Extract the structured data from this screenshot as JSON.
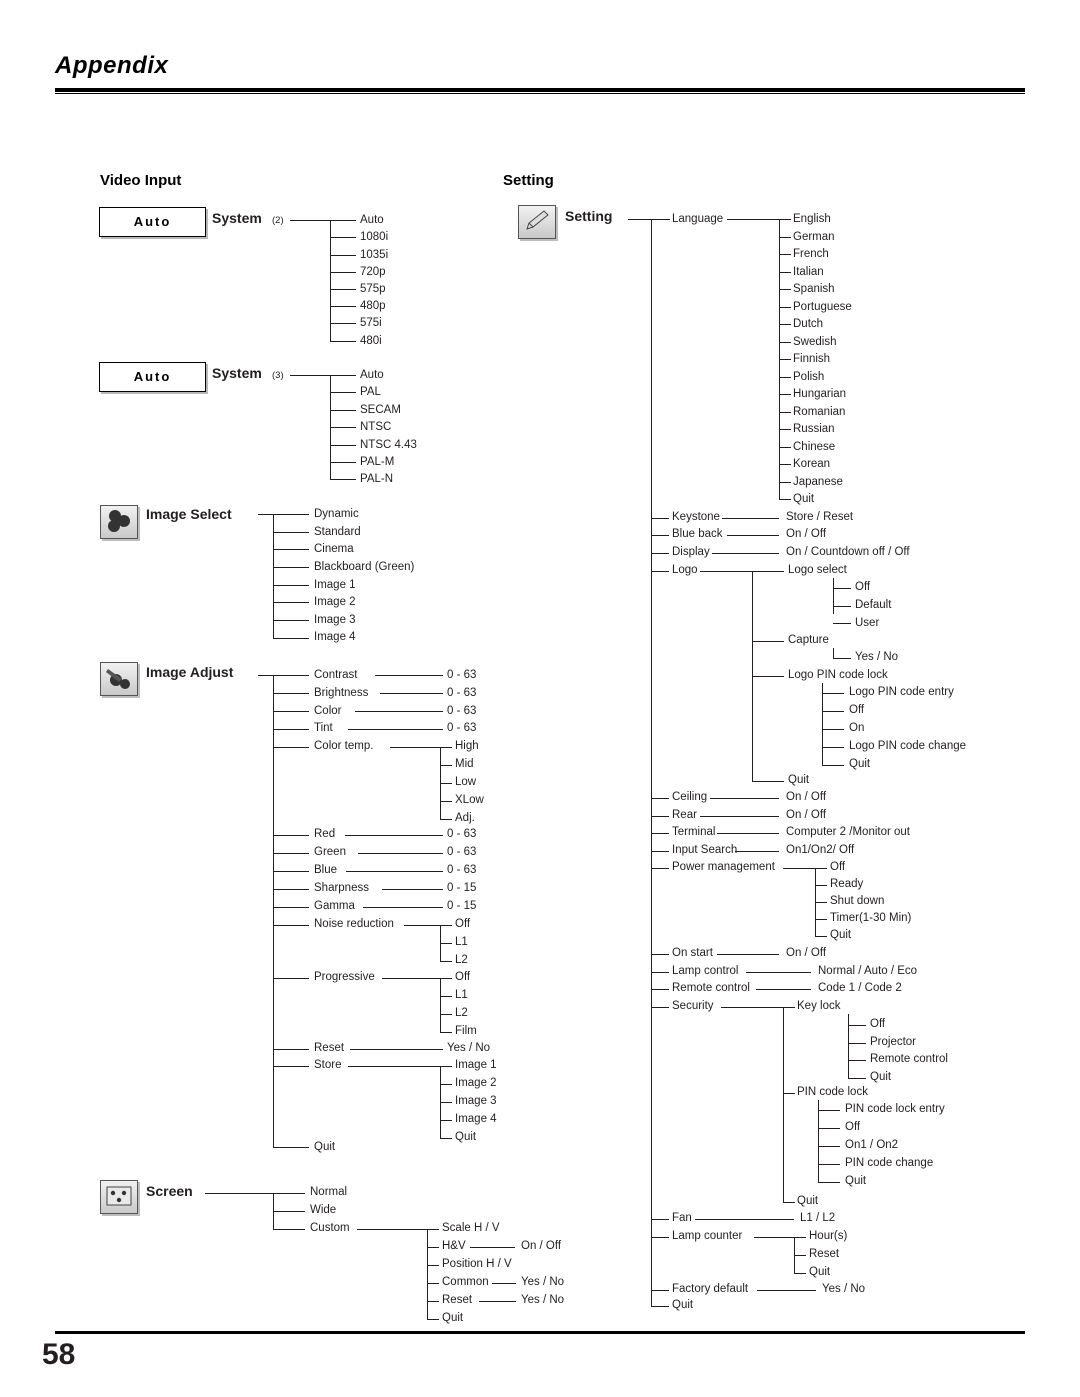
{
  "header": {
    "title": "Appendix"
  },
  "footer": {
    "page_number": "58"
  },
  "columns": {
    "left_title": "Video Input",
    "right_title": "Setting"
  },
  "buttons": {
    "auto1": "Auto",
    "auto2": "Auto"
  },
  "left": {
    "system2": {
      "label": "System",
      "suffix": "(2)",
      "items": [
        "Auto",
        "1080i",
        "1035i",
        "720p",
        "575p",
        "480p",
        "575i",
        "480i"
      ]
    },
    "system3": {
      "label": "System",
      "suffix": "(3)",
      "items": [
        "Auto",
        "PAL",
        "SECAM",
        "NTSC",
        "NTSC 4.43",
        "PAL-M",
        "PAL-N"
      ]
    },
    "image_select": {
      "label": "Image Select",
      "items": [
        "Dynamic",
        "Standard",
        "Cinema",
        "Blackboard (Green)",
        "Image 1",
        "Image 2",
        "Image 3",
        "Image 4"
      ]
    },
    "image_adjust": {
      "label": "Image Adjust",
      "rows": [
        {
          "name": "Contrast",
          "value": "0 - 63"
        },
        {
          "name": "Brightness",
          "value": "0 - 63"
        },
        {
          "name": "Color",
          "value": "0 - 63"
        },
        {
          "name": "Tint",
          "value": "0 - 63"
        }
      ],
      "color_temp": {
        "name": "Color temp.",
        "items": [
          "High",
          "Mid",
          "Low",
          "XLow",
          "Adj."
        ]
      },
      "rows2": [
        {
          "name": "Red",
          "value": "0 - 63"
        },
        {
          "name": "Green",
          "value": "0 - 63"
        },
        {
          "name": "Blue",
          "value": "0 - 63"
        },
        {
          "name": "Sharpness",
          "value": "0 - 15"
        },
        {
          "name": "Gamma",
          "value": "0 - 15"
        }
      ],
      "noise_reduction": {
        "name": "Noise reduction",
        "items": [
          "Off",
          "L1",
          "L2"
        ]
      },
      "progressive": {
        "name": "Progressive",
        "items": [
          "Off",
          "L1",
          "L2",
          "Film"
        ]
      },
      "reset": {
        "name": "Reset",
        "value": "Yes / No"
      },
      "store": {
        "name": "Store",
        "items": [
          "Image 1",
          "Image 2",
          "Image 3",
          "Image 4",
          "Quit"
        ]
      },
      "quit": "Quit"
    },
    "screen": {
      "label": "Screen",
      "items": [
        "Normal",
        "Wide",
        "Custom"
      ],
      "custom": {
        "rows": [
          {
            "name": "Scale H / V",
            "value": ""
          },
          {
            "name": "H&V",
            "value": "On / Off"
          },
          {
            "name": "Position H / V",
            "value": ""
          },
          {
            "name": "Common",
            "value": "Yes / No"
          },
          {
            "name": "Reset",
            "value": "Yes / No"
          },
          {
            "name": "Quit",
            "value": ""
          }
        ]
      }
    }
  },
  "right": {
    "title": "Setting",
    "language": {
      "label": "Language",
      "items": [
        "English",
        "German",
        "French",
        "Italian",
        "Spanish",
        "Portuguese",
        "Dutch",
        "Swedish",
        "Finnish",
        "Polish",
        "Hungarian",
        "Romanian",
        "Russian",
        "Chinese",
        "Korean",
        "Japanese",
        "Quit"
      ]
    },
    "rows": [
      {
        "name": "Keystone",
        "value": "Store / Reset"
      },
      {
        "name": "Blue back",
        "value": "On / Off"
      },
      {
        "name": "Display",
        "value": "On / Countdown off / Off"
      }
    ],
    "logo": {
      "label": "Logo",
      "logo_select": {
        "name": "Logo select",
        "items": [
          "Off",
          "Default",
          "User"
        ]
      },
      "capture": {
        "name": "Capture",
        "items": [
          "Yes / No"
        ]
      },
      "logo_pin_code_lock": {
        "name": "Logo PIN code lock",
        "items": [
          "Logo PIN code entry",
          "Off",
          "On",
          "Logo PIN code change",
          "Quit"
        ]
      },
      "quit": "Quit"
    },
    "rows2": [
      {
        "name": "Ceiling",
        "value": "On / Off"
      },
      {
        "name": "Rear",
        "value": "On / Off"
      },
      {
        "name": "Terminal",
        "value": "Computer 2 /Monitor out"
      },
      {
        "name": "Input Search",
        "value": "On1/On2/ Off"
      }
    ],
    "power_management": {
      "name": "Power management",
      "items": [
        "Off",
        "Ready",
        "Shut down",
        "Timer(1-30 Min)",
        "Quit"
      ]
    },
    "rows3": [
      {
        "name": "On start",
        "value": "On / Off"
      },
      {
        "name": "Lamp control",
        "value": "Normal / Auto / Eco"
      },
      {
        "name": "Remote control",
        "value": "Code 1 / Code 2"
      }
    ],
    "security": {
      "label": "Security",
      "key_lock": {
        "name": "Key lock",
        "items": [
          "Off",
          "Projector",
          "Remote control",
          "Quit"
        ]
      },
      "pin_code_lock": {
        "name": "PIN code lock",
        "items": [
          "PIN code lock entry",
          "Off",
          "On1 / On2",
          "PIN code change",
          "Quit"
        ]
      },
      "quit": "Quit"
    },
    "rows4": [
      {
        "name": "Fan",
        "value": "L1 / L2"
      }
    ],
    "lamp_counter": {
      "name": "Lamp counter",
      "items": [
        "Hour(s)",
        "Reset",
        "Quit"
      ]
    },
    "rows5": [
      {
        "name": "Factory default",
        "value": "Yes / No"
      }
    ],
    "quit": "Quit"
  }
}
